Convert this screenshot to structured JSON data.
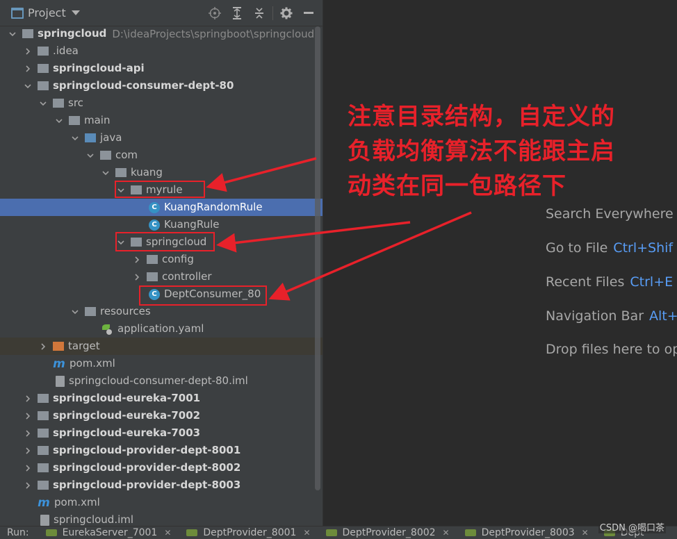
{
  "panel": {
    "title": "Project"
  },
  "tree": {
    "root": {
      "label": "springcloud",
      "path": "D:\\ideaProjects\\springboot\\springcloud"
    },
    "idea": ".idea",
    "api": "springcloud-api",
    "consumer": "springcloud-consumer-dept-80",
    "src": "src",
    "main": "main",
    "java": "java",
    "com": "com",
    "kuang": "kuang",
    "myrule": "myrule",
    "kuang_random_rule": "KuangRandomRule",
    "kuang_rule": "KuangRule",
    "springcloud_pkg": "springcloud",
    "config": "config",
    "controller": "controller",
    "dept_consumer": "DeptConsumer_80",
    "resources": "resources",
    "application_yaml": "application.yaml",
    "target": "target",
    "pom_inner": "pom.xml",
    "consumer_iml": "springcloud-consumer-dept-80.iml",
    "eureka_7001": "springcloud-eureka-7001",
    "eureka_7002": "springcloud-eureka-7002",
    "eureka_7003": "springcloud-eureka-7003",
    "provider_8001": "springcloud-provider-dept-8001",
    "provider_8002": "springcloud-provider-dept-8002",
    "provider_8003": "springcloud-provider-dept-8003",
    "pom_root": "pom.xml",
    "root_iml": "springcloud.iml"
  },
  "editor": {
    "hints": [
      {
        "text": "Search Everywhere",
        "key": ""
      },
      {
        "text": "Go to File",
        "key": "Ctrl+Shif"
      },
      {
        "text": "Recent Files",
        "key": "Ctrl+E"
      },
      {
        "text": "Navigation Bar",
        "key": "Alt+"
      },
      {
        "text": "Drop files here to op",
        "key": ""
      }
    ]
  },
  "annotation": {
    "line1": "注意目录结构，自定义的",
    "line2": "负载均衡算法不能跟主启",
    "line3": "动类在同一包路径下",
    "color": "#e8212a"
  },
  "run_bar": {
    "label": "Run:",
    "tabs": [
      "EurekaServer_7001",
      "DeptProvider_8001",
      "DeptProvider_8002",
      "DeptProvider_8003",
      "Dept"
    ]
  },
  "watermark": "CSDN @喝口茶",
  "colors": {
    "selection": "#4b6eaf",
    "accent_key": "#589df6"
  }
}
